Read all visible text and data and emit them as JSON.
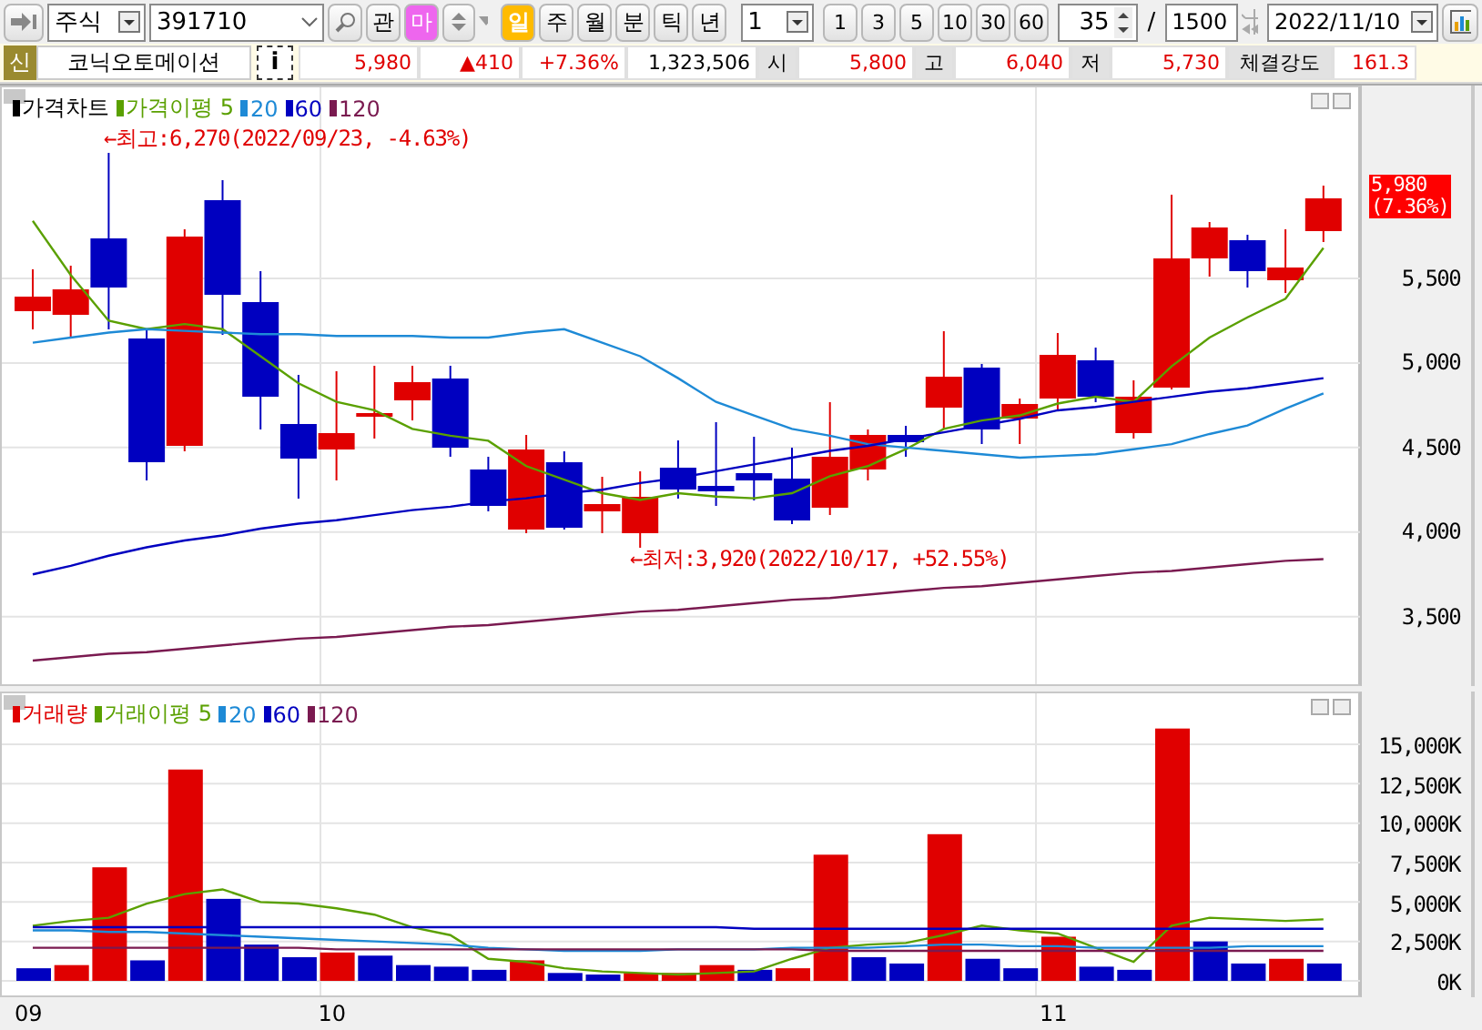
{
  "toolbar": {
    "market_select": "주식",
    "code": "391710",
    "buttons": [
      {
        "label": "관",
        "kind": "plain"
      },
      {
        "label": "마",
        "kind": "pink"
      }
    ],
    "periods": [
      {
        "label": "일",
        "selected": true
      },
      {
        "label": "주",
        "selected": false
      },
      {
        "label": "월",
        "selected": false
      },
      {
        "label": "분",
        "selected": false
      },
      {
        "label": "틱",
        "selected": false
      },
      {
        "label": "년",
        "selected": false
      }
    ],
    "interval_select": "1",
    "intervals": [
      "1",
      "3",
      "5",
      "10",
      "30",
      "60"
    ],
    "count": "35",
    "separator": "/",
    "max_count": "1500",
    "date": "2022/11/10"
  },
  "info": {
    "badge": "신",
    "name": "코닉오토메이션",
    "info_button": "i",
    "quote": [
      {
        "value": "5,980",
        "kind": "up"
      },
      {
        "value": "▲410",
        "kind": "up"
      },
      {
        "value": "+7.36%",
        "kind": "up"
      },
      {
        "value": "1,323,506",
        "kind": "plain"
      }
    ],
    "fields": [
      {
        "label": "시",
        "value": "5,800"
      },
      {
        "label": "고",
        "value": "6,040"
      },
      {
        "label": "저",
        "value": "5,730"
      },
      {
        "label": "체결강도",
        "value": "161.3"
      }
    ]
  },
  "price_pane": {
    "legend_title": {
      "label": "가격차트",
      "color": "#000000"
    },
    "high_note": "←최고:6,270(2022/09/23, -4.63%)",
    "low_note": "←최저:3,920(2022/10/17, +52.55%)",
    "current_tag": [
      "5,980",
      "(7.36%)"
    ],
    "chart_data": {
      "type": "line",
      "ylim": [
        3100,
        6630
      ],
      "grid": true,
      "legend": "upper left",
      "yticks": [
        {
          "value": 5500,
          "label": "5,500"
        },
        {
          "value": 5000,
          "label": "5,000"
        },
        {
          "value": 4500,
          "label": "4,500"
        },
        {
          "value": 4000,
          "label": "4,000"
        },
        {
          "value": 3500,
          "label": "3,500"
        }
      ],
      "series": [
        {
          "name": "가격이평 5",
          "color": "#5aa000",
          "values": [
            5840,
            5520,
            5250,
            5200,
            5230,
            5200,
            5040,
            4880,
            4770,
            4720,
            4610,
            4570,
            4540,
            4390,
            4310,
            4230,
            4190,
            4230,
            4210,
            4200,
            4230,
            4330,
            4390,
            4490,
            4610,
            4660,
            4690,
            4760,
            4800,
            4770,
            4980,
            5150,
            5270,
            5380,
            5680
          ]
        },
        {
          "name": "20",
          "color": "#1e8ad6",
          "values": [
            5120,
            5150,
            5180,
            5200,
            5190,
            5180,
            5170,
            5170,
            5160,
            5160,
            5160,
            5150,
            5150,
            5180,
            5200,
            5120,
            5040,
            4910,
            4770,
            4690,
            4610,
            4570,
            4520,
            4500,
            4480,
            4460,
            4440,
            4450,
            4460,
            4490,
            4520,
            4580,
            4630,
            4730,
            4820
          ]
        },
        {
          "name": "60",
          "color": "#0000c0",
          "values": [
            3750,
            3800,
            3860,
            3910,
            3950,
            3980,
            4020,
            4050,
            4070,
            4100,
            4130,
            4150,
            4180,
            4200,
            4230,
            4250,
            4290,
            4320,
            4360,
            4400,
            4440,
            4480,
            4510,
            4550,
            4590,
            4630,
            4670,
            4720,
            4740,
            4770,
            4800,
            4830,
            4850,
            4880,
            4910
          ]
        },
        {
          "name": "120",
          "color": "#7a1a50",
          "values": [
            3240,
            3260,
            3280,
            3290,
            3310,
            3330,
            3350,
            3370,
            3380,
            3400,
            3420,
            3440,
            3450,
            3470,
            3490,
            3510,
            3530,
            3540,
            3560,
            3580,
            3600,
            3610,
            3630,
            3650,
            3670,
            3680,
            3700,
            3720,
            3740,
            3760,
            3770,
            3790,
            3810,
            3830,
            3840
          ]
        }
      ]
    }
  },
  "volume_pane": {
    "chart_data": {
      "type": "bar",
      "grid": true,
      "legend": "upper left",
      "ylim": [
        0,
        18000
      ],
      "yticks": [
        {
          "value": 15000,
          "label": "15,000K"
        },
        {
          "value": 12500,
          "label": "12,500K"
        },
        {
          "value": 10000,
          "label": "10,000K"
        },
        {
          "value": 7500,
          "label": "7,500K"
        },
        {
          "value": 5000,
          "label": "5,000K"
        },
        {
          "value": 2500,
          "label": "2,500K"
        },
        {
          "value": 0,
          "label": "0K"
        }
      ],
      "series": [
        {
          "name": "거래량",
          "color": "#e00000",
          "values": [
            null,
            1000,
            7200,
            null,
            13400,
            null,
            null,
            null,
            1800,
            null,
            null,
            null,
            null,
            1300,
            null,
            null,
            500,
            500,
            1000,
            null,
            800,
            8000,
            null,
            null,
            9300,
            null,
            null,
            2800,
            null,
            null,
            16000,
            null,
            null,
            1400,
            null
          ]
        },
        {
          "color": "#0000c0",
          "values": [
            800,
            null,
            null,
            1300,
            null,
            5200,
            2300,
            1500,
            null,
            1600,
            1000,
            900,
            700,
            null,
            500,
            400,
            null,
            null,
            null,
            700,
            null,
            null,
            1500,
            1100,
            null,
            1400,
            800,
            null,
            900,
            700,
            null,
            2500,
            1100,
            null,
            1100
          ]
        },
        {
          "name": "거래이평 5",
          "type": "line",
          "color": "#5aa000",
          "values": [
            3500,
            3800,
            4000,
            4900,
            5500,
            5800,
            5000,
            4900,
            4600,
            4200,
            3400,
            2900,
            1400,
            1200,
            800,
            600,
            500,
            400,
            500,
            600,
            1400,
            2100,
            2300,
            2400,
            2900,
            3500,
            3200,
            3000,
            2100,
            1200,
            3500,
            4000,
            3900,
            3800,
            3900
          ]
        },
        {
          "name": "20",
          "type": "line",
          "color": "#1e8ad6",
          "values": [
            3200,
            3200,
            3100,
            3100,
            3000,
            2900,
            2800,
            2700,
            2600,
            2500,
            2400,
            2300,
            2100,
            2000,
            1900,
            1900,
            1900,
            2000,
            2000,
            2000,
            2100,
            2100,
            2100,
            2200,
            2300,
            2300,
            2200,
            2200,
            2100,
            2100,
            2100,
            2100,
            2200,
            2200,
            2200
          ]
        },
        {
          "name": "60",
          "type": "line",
          "color": "#0000c0",
          "values": [
            3400,
            3400,
            3400,
            3400,
            3400,
            3400,
            3400,
            3400,
            3400,
            3400,
            3400,
            3400,
            3400,
            3400,
            3400,
            3400,
            3400,
            3400,
            3400,
            3300,
            3300,
            3300,
            3300,
            3300,
            3300,
            3300,
            3300,
            3300,
            3300,
            3300,
            3300,
            3300,
            3300,
            3300,
            3300
          ]
        },
        {
          "name": "120",
          "type": "line",
          "color": "#7a1a50",
          "values": [
            2100,
            2100,
            2100,
            2100,
            2100,
            2100,
            2100,
            2100,
            2000,
            2000,
            2000,
            2000,
            2000,
            2000,
            2000,
            2000,
            2000,
            2000,
            2000,
            2000,
            2000,
            1900,
            1900,
            1900,
            1900,
            1900,
            1900,
            1900,
            1900,
            1900,
            1900,
            1900,
            1900,
            1900,
            1900
          ]
        }
      ]
    },
    "date_axis": [
      "09",
      "10",
      "11"
    ]
  }
}
